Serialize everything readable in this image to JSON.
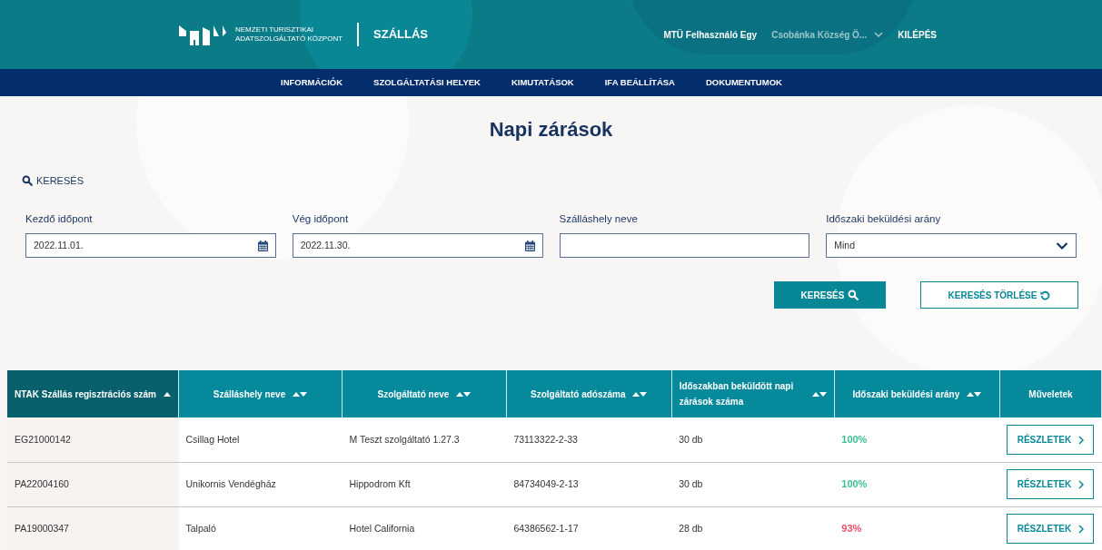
{
  "header": {
    "org_line1": "NEMZETI TURISZTIKAI",
    "org_line2": "ADATSZOLGÁLTATÓ KÖZPONT",
    "app": "SZÁLLÁS",
    "user": "MTÜ Felhasználó Egy",
    "location": "Csobánka Község Ö...",
    "logout": "KILÉPÉS"
  },
  "nav": [
    "INFORMÁCIÓK",
    "SZOLGÁLTATÁSI HELYEK",
    "KIMUTATÁSOK",
    "IFA BEÁLLÍTÁSA",
    "DOKUMENTUMOK"
  ],
  "page_title": "Napi zárások",
  "search_toggle": "KERESÉS",
  "filters": [
    {
      "kind": "date",
      "label": "Kezdő időpont",
      "value": "2022.11.01."
    },
    {
      "kind": "date",
      "label": "Vég időpont",
      "value": "2022.11.30."
    },
    {
      "kind": "text",
      "label": "Szálláshely neve"
    },
    {
      "kind": "select",
      "label": "Időszaki beküldési arány",
      "value": "Mind"
    }
  ],
  "search_button": "KERESÉS",
  "clear_button": "KERESÉS TÖRLÉSE",
  "table": {
    "columns": [
      {
        "label": "NTAK Szállás regisztrációs szám",
        "sortable": true,
        "sorted": true
      },
      {
        "label": "Szálláshely neve",
        "sortable": true,
        "sorted": false
      },
      {
        "label": "Szolgáltató neve",
        "sortable": true,
        "sorted": false
      },
      {
        "label": "Szolgáltató adószáma",
        "sortable": true,
        "sorted": false
      },
      {
        "label": "Időszakban beküldött napi zárások száma",
        "sortable": true,
        "sorted": false
      },
      {
        "label": "Időszaki beküldési arány",
        "sortable": true,
        "sorted": false
      },
      {
        "label": "Műveletek",
        "sortable": false,
        "sorted": false
      }
    ],
    "rows": [
      {
        "cells": [
          "EG21000142",
          "Csillag Hotel",
          "M Teszt szolgáltató 1.27.3",
          "73113322-2-33",
          "30 db",
          "100%"
        ],
        "color": "#3dbf94",
        "action": "RÉSZLETEK"
      },
      {
        "cells": [
          "PA22004160",
          "Unikornis Vendégház",
          "Hippodrom Kft",
          "84734049-2-13",
          "30 db",
          "100%"
        ],
        "color": "#3dbf94",
        "action": "RÉSZLETEK"
      },
      {
        "cells": [
          "PA19000347",
          "Talpaló",
          "Hotel California",
          "64386562-1-17",
          "28 db",
          "93%"
        ],
        "color": "#e8506a",
        "action": "RÉSZLETEK"
      }
    ]
  }
}
